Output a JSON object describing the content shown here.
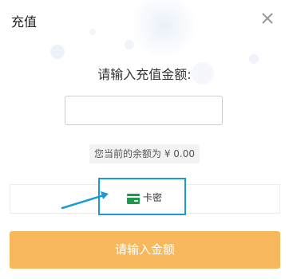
{
  "dialog": {
    "title": "充值",
    "prompt": "请输入充值金额:",
    "amount_input": {
      "value": "",
      "placeholder": ""
    },
    "balance_text": "您当前的余额为 ¥ 0.00",
    "payment_method": {
      "label": "卡密",
      "icon": "card-icon",
      "color": "#1a9c4a"
    },
    "submit_label": "请输入金额",
    "colors": {
      "submit_bg": "#f7b75b",
      "highlight_border": "#1a9ad6",
      "annotation_arrow": "#1a9ad6"
    }
  }
}
